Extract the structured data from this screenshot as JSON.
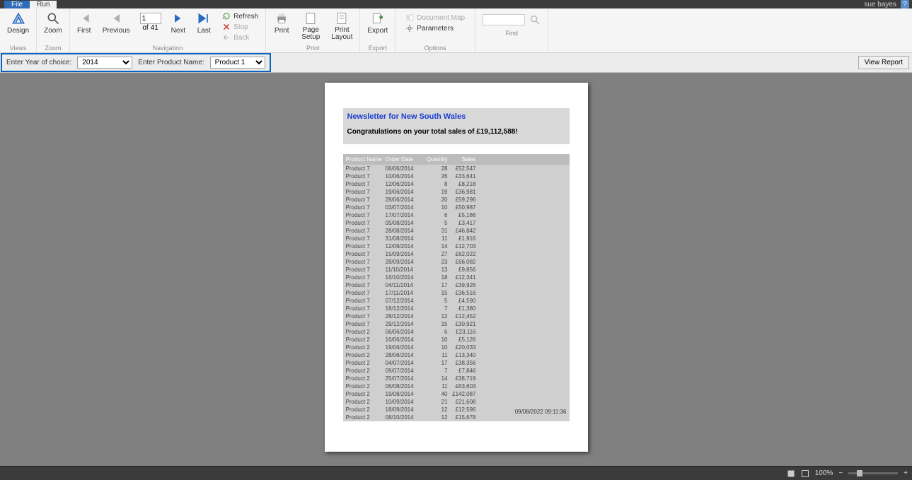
{
  "titlebar": {
    "user": "sue bayes",
    "help_icon": "?"
  },
  "tabs": {
    "file": "File",
    "run": "Run"
  },
  "ribbon": {
    "views": {
      "design": "Design",
      "group": "Views"
    },
    "zoom": {
      "zoom": "Zoom",
      "group": "Zoom"
    },
    "nav": {
      "first": "First",
      "prev": "Previous",
      "next": "Next",
      "last": "Last",
      "of": "of",
      "total_pages": "41",
      "current_page": "1",
      "group": "Navigation",
      "refresh": "Refresh",
      "stop": "Stop",
      "back": "Back"
    },
    "print": {
      "print": "Print",
      "page_setup": "Page\nSetup",
      "print_layout": "Print\nLayout",
      "group": "Print"
    },
    "export": {
      "export": "Export",
      "group": "Export"
    },
    "options": {
      "doc_map": "Document Map",
      "parameters": "Parameters",
      "group": "Options"
    },
    "find": {
      "group": "Find",
      "find_label": "Find"
    }
  },
  "params": {
    "year_label": "Enter Year of choice:",
    "year_value": "2014",
    "product_label": "Enter Product Name:",
    "product_value": "Product 1",
    "view_report": "View Report"
  },
  "report": {
    "title": "Newsletter for New South Wales",
    "congrats": "Congratulations on your total sales of £19,112,588!",
    "columns": {
      "pn": "Product Name",
      "od": "Order Date",
      "qt": "Quantity",
      "sl": "Sales"
    },
    "rows": [
      {
        "pn": "Product 7",
        "od": "06/06/2014",
        "qt": "28",
        "sl": "£52,547"
      },
      {
        "pn": "Product 7",
        "od": "10/06/2014",
        "qt": "26",
        "sl": "£33,641"
      },
      {
        "pn": "Product 7",
        "od": "12/06/2014",
        "qt": "8",
        "sl": "£8,218"
      },
      {
        "pn": "Product 7",
        "od": "19/06/2014",
        "qt": "19",
        "sl": "£36,981"
      },
      {
        "pn": "Product 7",
        "od": "28/06/2014",
        "qt": "20",
        "sl": "£59,296"
      },
      {
        "pn": "Product 7",
        "od": "03/07/2014",
        "qt": "10",
        "sl": "£50,987"
      },
      {
        "pn": "Product 7",
        "od": "17/07/2014",
        "qt": "6",
        "sl": "£5,186"
      },
      {
        "pn": "Product 7",
        "od": "05/08/2014",
        "qt": "5",
        "sl": "£3,417"
      },
      {
        "pn": "Product 7",
        "od": "28/08/2014",
        "qt": "31",
        "sl": "£46,842"
      },
      {
        "pn": "Product 7",
        "od": "31/08/2014",
        "qt": "11",
        "sl": "£1,916"
      },
      {
        "pn": "Product 7",
        "od": "12/09/2014",
        "qt": "14",
        "sl": "£12,703"
      },
      {
        "pn": "Product 7",
        "od": "15/09/2014",
        "qt": "27",
        "sl": "£62,022"
      },
      {
        "pn": "Product 7",
        "od": "28/09/2014",
        "qt": "23",
        "sl": "£66,082"
      },
      {
        "pn": "Product 7",
        "od": "11/10/2014",
        "qt": "13",
        "sl": "£9,856"
      },
      {
        "pn": "Product 7",
        "od": "16/10/2014",
        "qt": "18",
        "sl": "£12,341"
      },
      {
        "pn": "Product 7",
        "od": "04/11/2014",
        "qt": "17",
        "sl": "£39,926"
      },
      {
        "pn": "Product 7",
        "od": "17/11/2014",
        "qt": "15",
        "sl": "£36,516"
      },
      {
        "pn": "Product 7",
        "od": "07/12/2014",
        "qt": "5",
        "sl": "£4,590"
      },
      {
        "pn": "Product 7",
        "od": "18/12/2014",
        "qt": "7",
        "sl": "£1,380"
      },
      {
        "pn": "Product 7",
        "od": "28/12/2014",
        "qt": "12",
        "sl": "£12,452"
      },
      {
        "pn": "Product 7",
        "od": "29/12/2014",
        "qt": "15",
        "sl": "£30,921"
      },
      {
        "pn": "Product 2",
        "od": "06/06/2014",
        "qt": "6",
        "sl": "£23,116"
      },
      {
        "pn": "Product 2",
        "od": "16/06/2014",
        "qt": "10",
        "sl": "£5,126"
      },
      {
        "pn": "Product 2",
        "od": "19/06/2014",
        "qt": "10",
        "sl": "£20,033"
      },
      {
        "pn": "Product 2",
        "od": "28/06/2014",
        "qt": "11",
        "sl": "£13,340"
      },
      {
        "pn": "Product 2",
        "od": "04/07/2014",
        "qt": "17",
        "sl": "£38,356"
      },
      {
        "pn": "Product 2",
        "od": "09/07/2014",
        "qt": "7",
        "sl": "£7,846"
      },
      {
        "pn": "Product 2",
        "od": "25/07/2014",
        "qt": "14",
        "sl": "£38,719"
      },
      {
        "pn": "Product 2",
        "od": "06/08/2014",
        "qt": "11",
        "sl": "£63,603"
      },
      {
        "pn": "Product 2",
        "od": "19/08/2014",
        "qt": "40",
        "sl": "£142,087"
      },
      {
        "pn": "Product 2",
        "od": "10/09/2014",
        "qt": "21",
        "sl": "£21,608"
      },
      {
        "pn": "Product 2",
        "od": "18/09/2014",
        "qt": "12",
        "sl": "£12,596"
      },
      {
        "pn": "Product 2",
        "od": "08/10/2014",
        "qt": "12",
        "sl": "£15,678"
      }
    ],
    "footer_time": "09/08/2022 09:11:36"
  },
  "status": {
    "zoom": "100%"
  }
}
